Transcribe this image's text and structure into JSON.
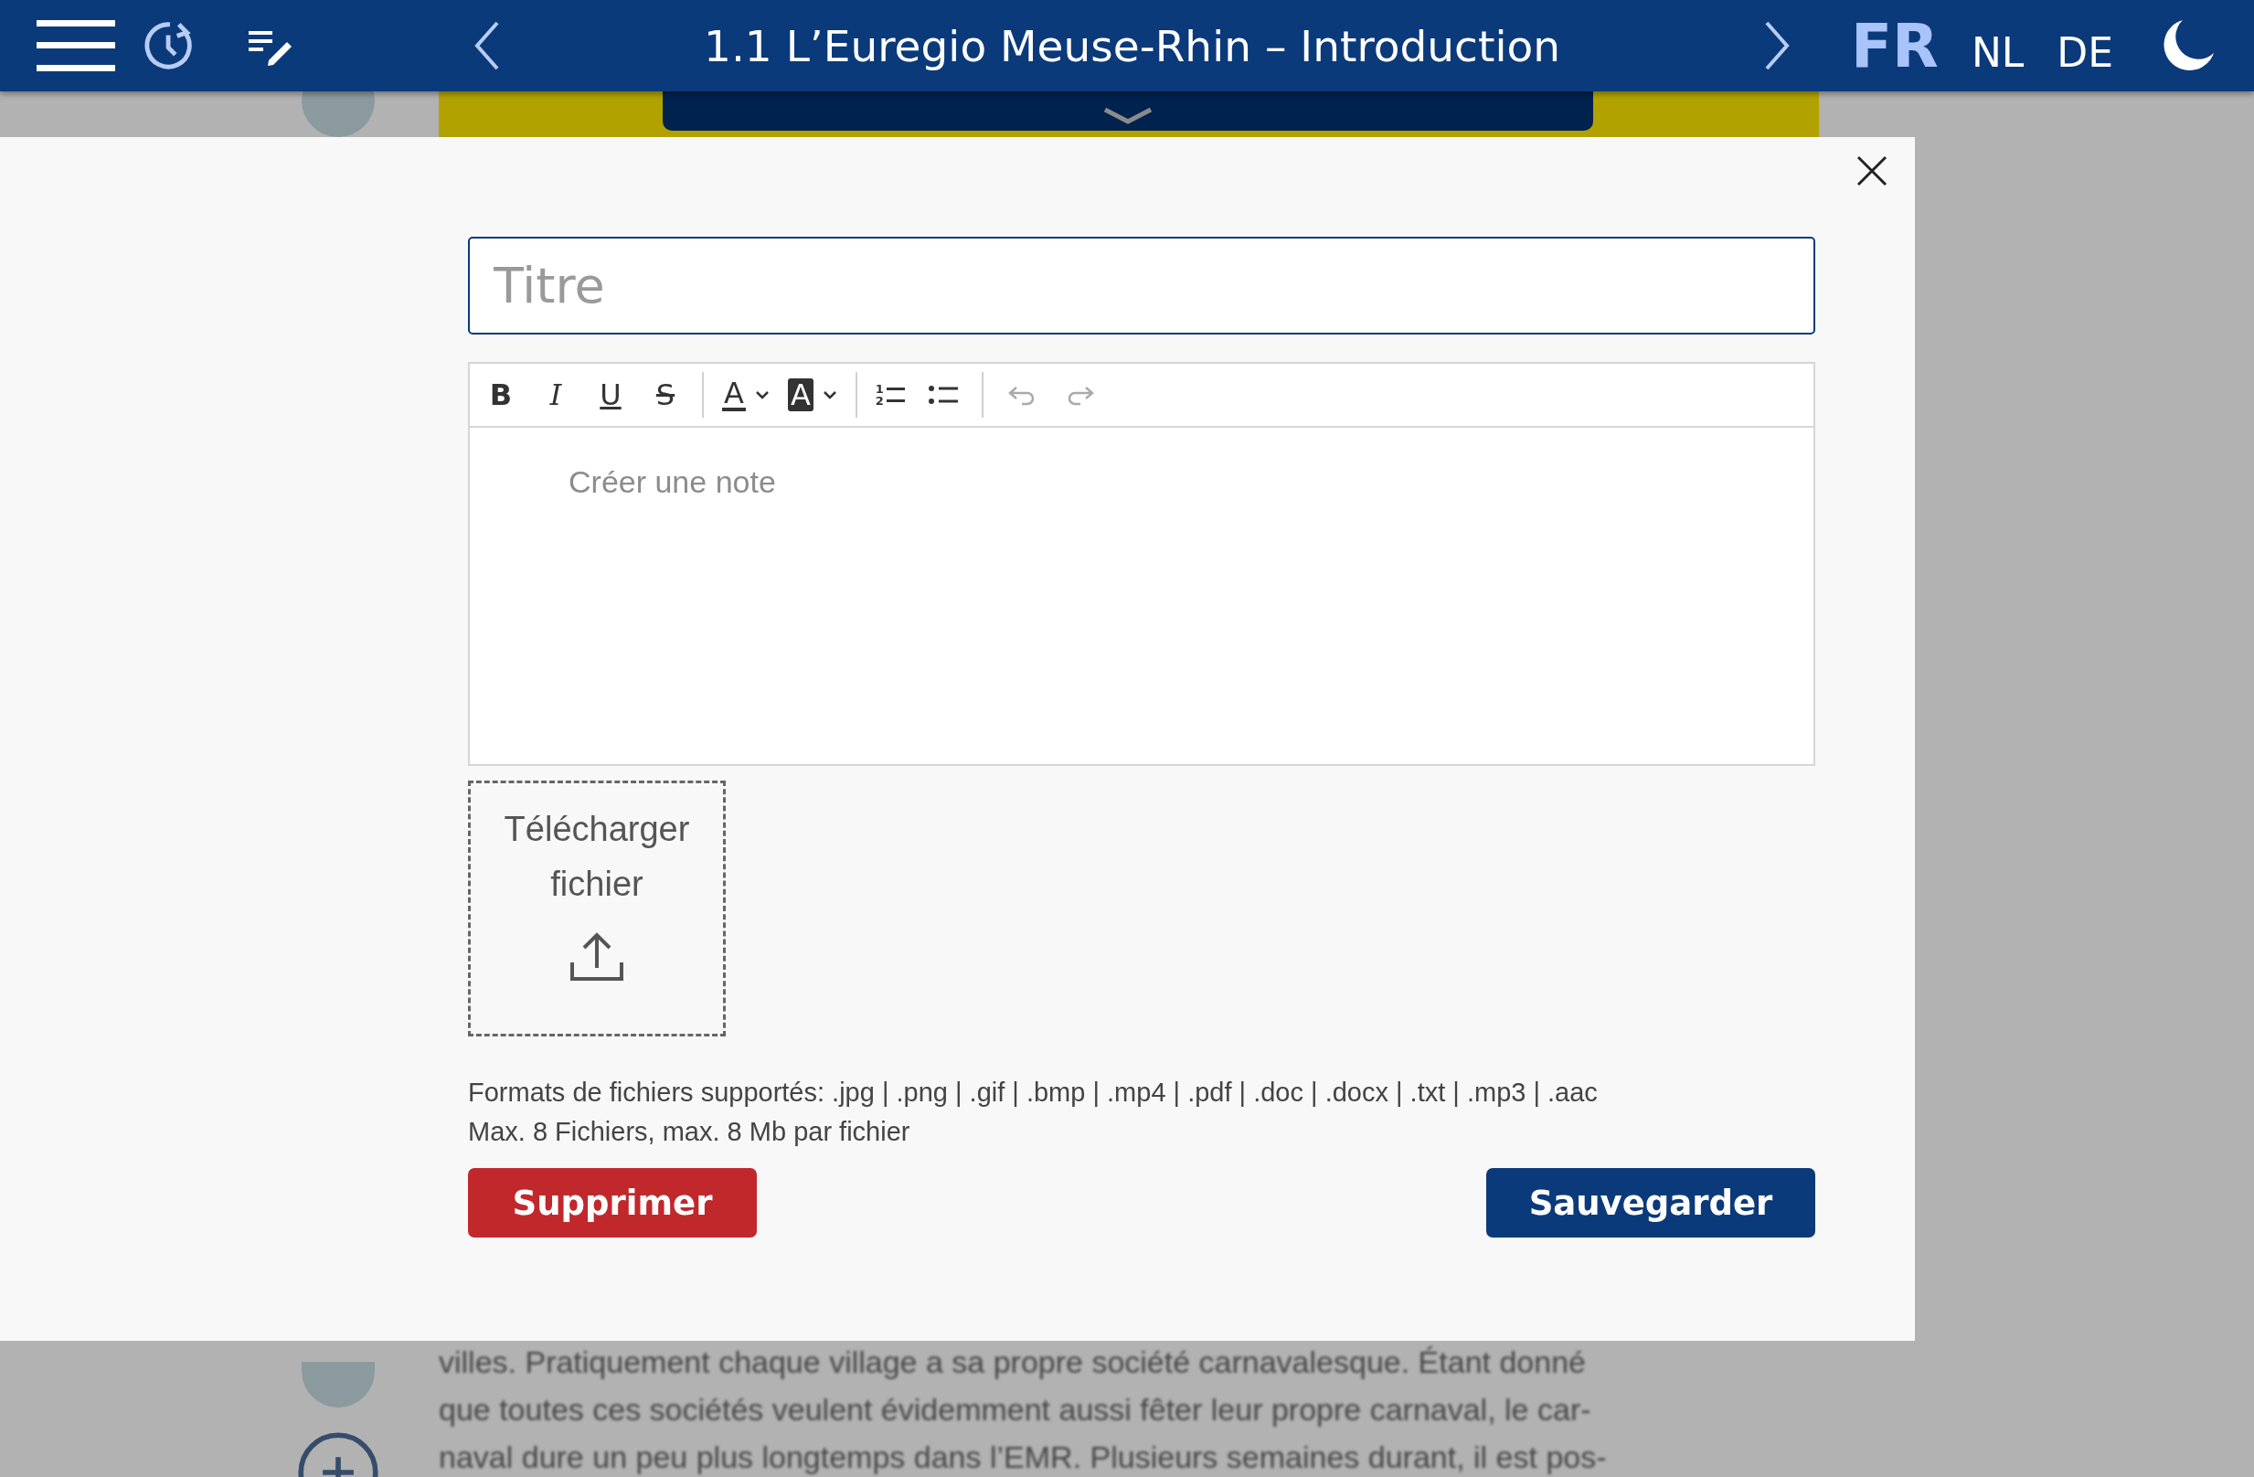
{
  "header": {
    "title": "1.1 L’Euregio Meuse-Rhin – Introduction",
    "languages": [
      {
        "label": "FR",
        "selected": true
      },
      {
        "label": "NL",
        "selected": false
      },
      {
        "label": "DE",
        "selected": false
      }
    ]
  },
  "background_text": [
    "villes. Pratiquement chaque village a sa propre société carnavalesque. Étant donné",
    "que toutes ces sociétés veulent évidemment aussi fêter leur propre carnaval, le car-",
    "naval dure un peu plus longtemps dans l’EMR. Plusieurs semaines durant, il est pos-"
  ],
  "note_editor": {
    "title_placeholder": "Titre",
    "toolbar": [
      {
        "kind": "bold",
        "glyph": "B"
      },
      {
        "kind": "italic",
        "glyph": "I"
      },
      {
        "kind": "underline",
        "glyph": "U"
      },
      {
        "kind": "strike",
        "glyph": "S"
      },
      {
        "kind": "separator"
      },
      {
        "kind": "text-color",
        "glyph": "A"
      },
      {
        "kind": "highlight",
        "glyph": "A"
      },
      {
        "kind": "separator"
      },
      {
        "kind": "ordered-list",
        "marks": [
          "1",
          "2"
        ]
      },
      {
        "kind": "bullet-list"
      },
      {
        "kind": "separator"
      },
      {
        "kind": "undo",
        "disabled": true
      },
      {
        "kind": "redo",
        "disabled": true
      }
    ],
    "body_placeholder": "Créer une note",
    "upload_label": "Télécharger fichier",
    "hints": [
      "Formats de fichiers supportés: .jpg | .png | .gif | .bmp | .mp4 | .pdf | .doc | .docx | .txt | .mp3 | .aac",
      "Max. 8 Fichiers, max. 8 Mb par fichier"
    ],
    "buttons": [
      {
        "kind": "delete",
        "label": "Supprimer"
      },
      {
        "kind": "save",
        "label": "Sauvegarder"
      }
    ]
  }
}
